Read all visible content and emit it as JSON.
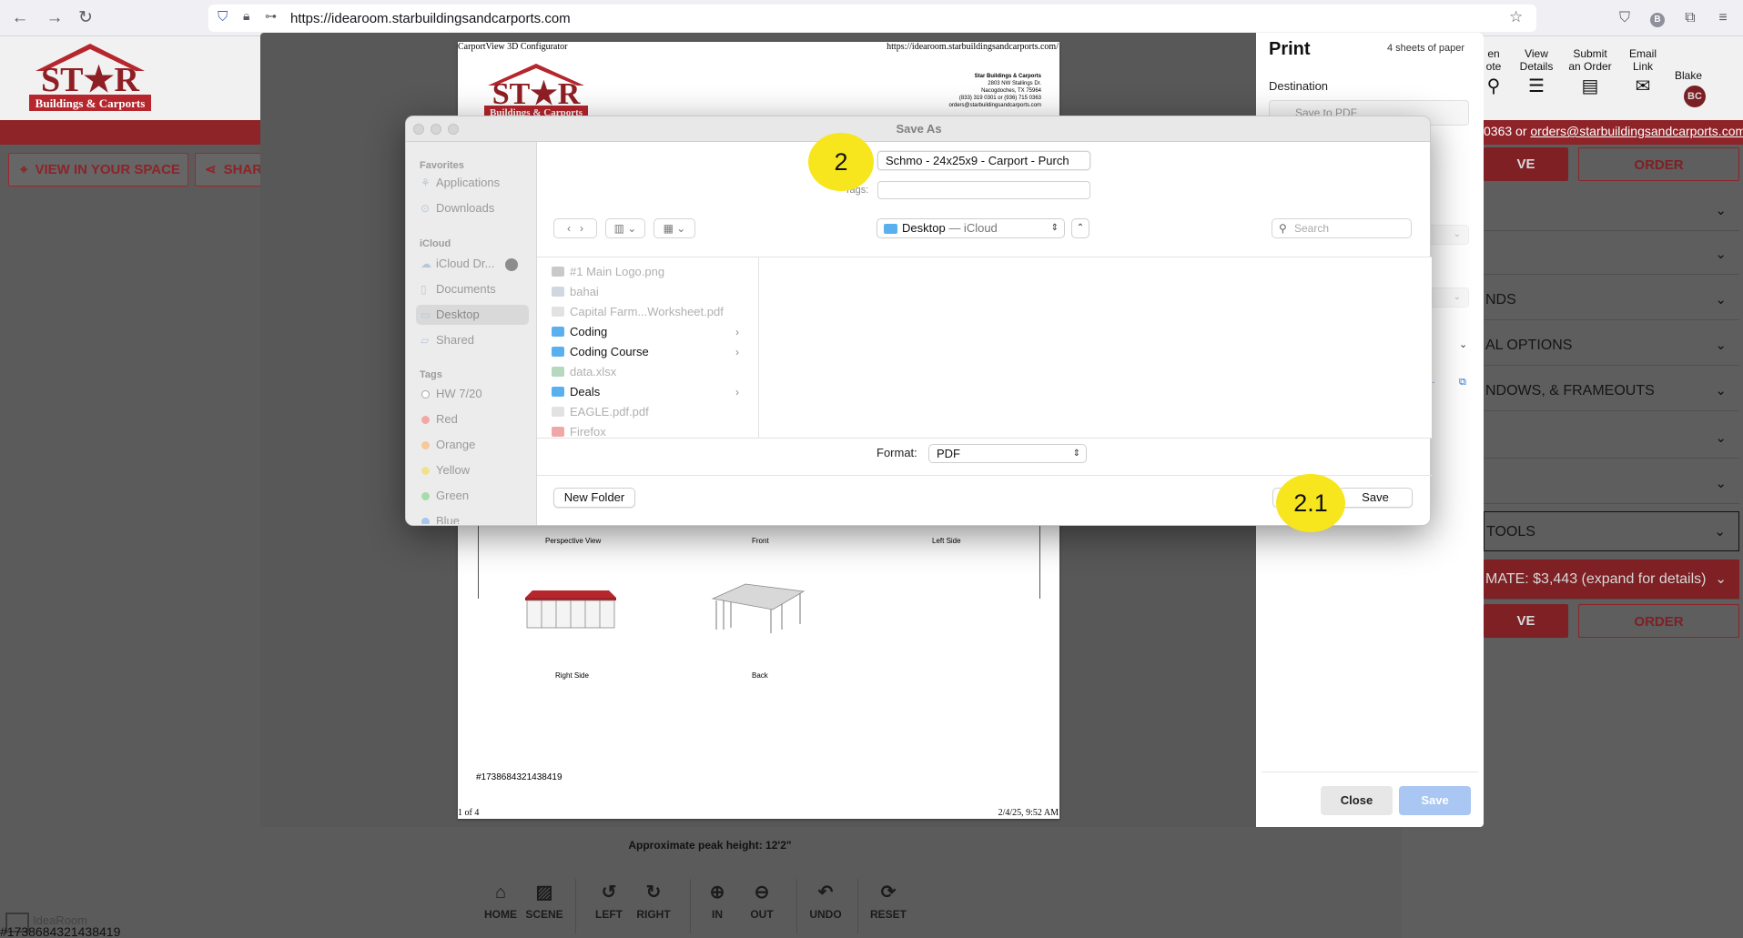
{
  "browser": {
    "url_prefix": "https://idearoom.",
    "url_domain": "starbuildingsandcarports.com",
    "extension_badge": "B"
  },
  "site": {
    "logo_text_top": "ST★R",
    "logo_text_bottom": "Buildings & Carports",
    "contact": "0363 or ",
    "contact_email": "orders@starbuildingsandcarports.com",
    "view_in_space": "VIEW IN YOUR SPACE",
    "share": "SHAR",
    "nav": [
      {
        "label": "en\note",
        "icon": "search-icon"
      },
      {
        "label": "View\nDetails",
        "icon": "list-icon"
      },
      {
        "label": "Submit\nan Order",
        "icon": "document-icon"
      },
      {
        "label": "Email\nLink",
        "icon": "mail-icon"
      }
    ],
    "user_name": "Blake",
    "user_initials": "BC",
    "save_label": "VE",
    "order_label": "ORDER",
    "accordion": [
      "",
      "",
      "NDS",
      "AL OPTIONS",
      "NDOWS, & FRAMEOUTS",
      "",
      "",
      "TOOLS"
    ],
    "estimate": "MATE: $3,443 (expand for details)",
    "peak_height": "Approximate peak height: 12'2\"",
    "watermark": "IdeaRoom",
    "quote_id": "#1738684321438419",
    "toolbar": [
      "HOME",
      "SCENE",
      "LEFT",
      "RIGHT",
      "IN",
      "OUT",
      "UNDO",
      "RESET"
    ]
  },
  "print": {
    "title": "Print",
    "sheets": "4 sheets of paper",
    "destination_label": "Destination",
    "destination_value": "Save to PDF",
    "close": "Close",
    "save": "Save",
    "preview": {
      "header_left": "CarportView 3D Configurator",
      "header_right": "https://idearoom.starbuildingsandcarports.com/",
      "company": "Star Buildings & Carports",
      "address1": "2803 NW Stallings Dr.",
      "address2": "Nacogdoches, TX 75964",
      "phone": "(833) 319 0301 or (936) 715 0363",
      "email": "orders@starbuildingsandcarports.com",
      "captions_top": [
        "Perspective View",
        "Front",
        "Left Side"
      ],
      "captions_bottom": [
        "Right Side",
        "Back"
      ],
      "id": "#1738684321438419",
      "footer_left": "1 of 4",
      "footer_right": "2/4/25, 9:52 AM"
    }
  },
  "save_as": {
    "title": "Save As",
    "filename": "Schmo - 24x25x9 - Carport - Purch",
    "tags_label": "Tags:",
    "location": "Desktop",
    "location_sub": " — iCloud",
    "search_placeholder": "Search",
    "sidebar": {
      "favorites_head": "Favorites",
      "favorites": [
        "Applications",
        "Downloads"
      ],
      "icloud_head": "iCloud",
      "icloud": [
        "iCloud Dr...",
        "Documents",
        "Desktop",
        "Shared"
      ],
      "tags_head": "Tags",
      "tags": [
        {
          "label": "HW 7/20",
          "color": "#ffffff"
        },
        {
          "label": "Red",
          "color": "#f4a7a5"
        },
        {
          "label": "Orange",
          "color": "#f6c99b"
        },
        {
          "label": "Yellow",
          "color": "#f3e08e"
        },
        {
          "label": "Green",
          "color": "#a8dbaa"
        },
        {
          "label": "Blue",
          "color": "#a9c4ef"
        }
      ]
    },
    "files": [
      {
        "name": "#1 Main Logo.png",
        "folder": false
      },
      {
        "name": "bahai",
        "folder": false
      },
      {
        "name": "Capital Farm...Worksheet.pdf",
        "folder": false
      },
      {
        "name": "Coding",
        "folder": true
      },
      {
        "name": "Coding Course",
        "folder": true
      },
      {
        "name": "data.xlsx",
        "folder": false
      },
      {
        "name": "Deals",
        "folder": true
      },
      {
        "name": "EAGLE.pdf.pdf",
        "folder": false
      },
      {
        "name": "Firefox",
        "folder": false
      }
    ],
    "format_label": "Format:",
    "format_value": "PDF",
    "new_folder": "New Folder",
    "save": "Save"
  },
  "callouts": [
    "2",
    "2.1"
  ],
  "colors": {
    "brand_red": "#b5262d",
    "callout_yellow": "#f7e61d",
    "folder_blue": "#5ab0ee"
  }
}
